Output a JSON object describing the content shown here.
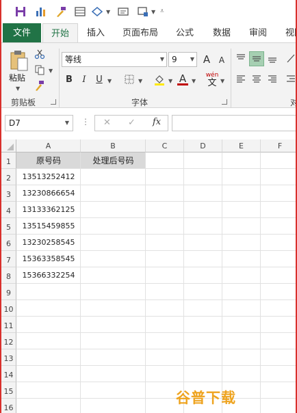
{
  "ribbon_tabs": [
    "文件",
    "开始",
    "插入",
    "页面布局",
    "公式",
    "数据",
    "审阅",
    "视图"
  ],
  "clipboard": {
    "paste_label": "粘贴",
    "group_label": "剪贴板"
  },
  "font": {
    "name": "等线",
    "size": "9",
    "group_label": "字体",
    "bold": "B",
    "italic": "I",
    "underline": "U",
    "grow": "A",
    "shrink": "A",
    "font_color": "A",
    "phonetic_top": "wén",
    "phonetic_bottom": "文"
  },
  "alignment": {
    "group_label_partial": "对"
  },
  "formula_bar": {
    "name_box": "D7",
    "fx": "fx",
    "cancel": "✕",
    "enter": "✓"
  },
  "columns": [
    "A",
    "B",
    "C",
    "D",
    "E",
    "F"
  ],
  "rows": [
    "1",
    "2",
    "3",
    "4",
    "5",
    "6",
    "7",
    "8",
    "9",
    "10",
    "11",
    "12",
    "13",
    "14",
    "15",
    "16"
  ],
  "sheet": {
    "header_a": "原号码",
    "header_b": "处理后号码",
    "phone_numbers": [
      "13513252412",
      "13230866654",
      "13133362125",
      "13515459855",
      "13230258545",
      "15363358545",
      "15366332254"
    ]
  },
  "watermark": "谷普下载",
  "colors": {
    "accent": "#217346",
    "border": "#d9302c",
    "watermark": "#eea31e"
  }
}
